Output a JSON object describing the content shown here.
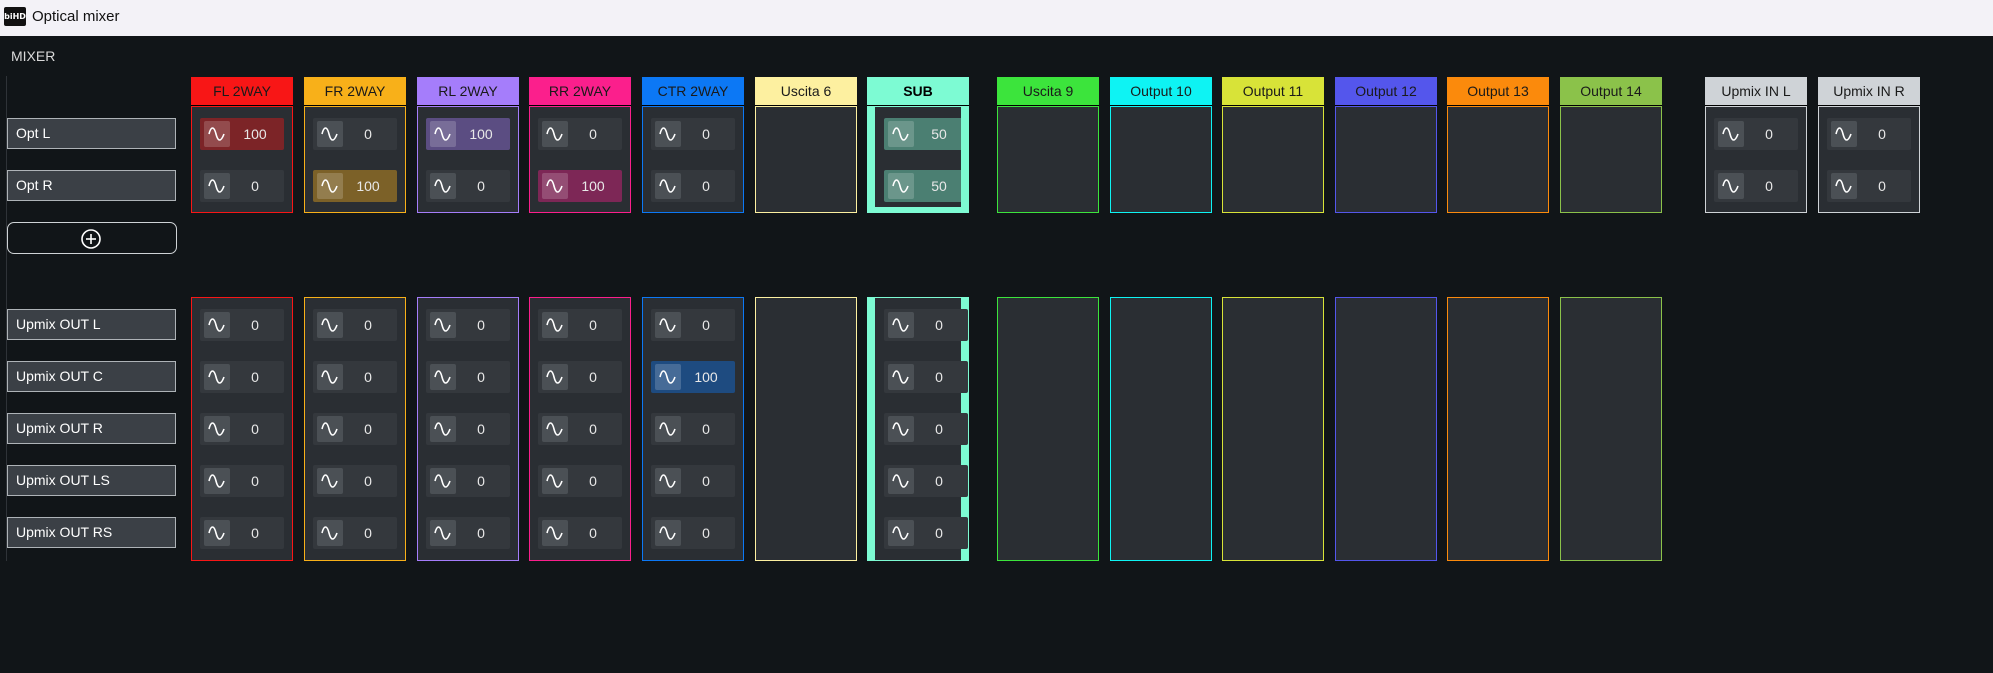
{
  "window": {
    "title": "Optical mixer",
    "logo_text": "biHD"
  },
  "section": {
    "label": "MIXER"
  },
  "rows_top": [
    "Opt L",
    "Opt R"
  ],
  "rows_bottom": [
    "Upmix OUT L",
    "Upmix OUT C",
    "Upmix OUT R",
    "Upmix OUT LS",
    "Upmix OUT RS"
  ],
  "columns": [
    {
      "label": "FL 2WAY",
      "color": "#f81616",
      "header_text": "#1a1a1a",
      "top": [
        {
          "v": "100",
          "hl": true
        },
        {
          "v": "0",
          "hl": false
        }
      ],
      "bottom": [
        "0",
        "0",
        "0",
        "0",
        "0"
      ],
      "bottom_hl": [
        false,
        false,
        false,
        false,
        false
      ]
    },
    {
      "label": "FR 2WAY",
      "color": "#f8b019",
      "header_text": "#1a1a1a",
      "top": [
        {
          "v": "0",
          "hl": false
        },
        {
          "v": "100",
          "hl": true
        }
      ],
      "bottom": [
        "0",
        "0",
        "0",
        "0",
        "0"
      ],
      "bottom_hl": [
        false,
        false,
        false,
        false,
        false
      ]
    },
    {
      "label": "RL 2WAY",
      "color": "#a57dfb",
      "header_text": "#1a1a1a",
      "top": [
        {
          "v": "100",
          "hl": true
        },
        {
          "v": "0",
          "hl": false
        }
      ],
      "bottom": [
        "0",
        "0",
        "0",
        "0",
        "0"
      ],
      "bottom_hl": [
        false,
        false,
        false,
        false,
        false
      ]
    },
    {
      "label": "RR 2WAY",
      "color": "#fb1f8c",
      "header_text": "#1a1a1a",
      "top": [
        {
          "v": "0",
          "hl": false
        },
        {
          "v": "100",
          "hl": true
        }
      ],
      "bottom": [
        "0",
        "0",
        "0",
        "0",
        "0"
      ],
      "bottom_hl": [
        false,
        false,
        false,
        false,
        false
      ]
    },
    {
      "label": "CTR 2WAY",
      "color": "#0c78f5",
      "header_text": "#1a1a1a",
      "top": [
        {
          "v": "0",
          "hl": false
        },
        {
          "v": "0",
          "hl": false
        }
      ],
      "bottom": [
        "0",
        "100",
        "0",
        "0",
        "0"
      ],
      "bottom_hl": [
        false,
        true,
        false,
        false,
        false
      ]
    },
    {
      "label": "Uscita 6",
      "color": "#fdf0a0",
      "header_text": "#1a1a1a",
      "top": [],
      "bottom": [],
      "bottom_hl": []
    },
    {
      "label": "SUB",
      "color": "#7dfbd3",
      "header_text": "#000000",
      "sub": true,
      "top": [
        {
          "v": "50",
          "hl": true
        },
        {
          "v": "50",
          "hl": true
        }
      ],
      "bottom": [
        "0",
        "0",
        "0",
        "0",
        "0"
      ],
      "bottom_hl": [
        false,
        false,
        false,
        false,
        false
      ]
    },
    {
      "label": "Uscita 9",
      "color": "#3ce43c",
      "header_text": "#1a1a1a",
      "top": [],
      "bottom": [],
      "bottom_hl": []
    },
    {
      "label": "Output 10",
      "color": "#0ef3f3",
      "header_text": "#1a1a1a",
      "top": [],
      "bottom": [],
      "bottom_hl": []
    },
    {
      "label": "Output 11",
      "color": "#d8e338",
      "header_text": "#1a1a1a",
      "top": [],
      "bottom": [],
      "bottom_hl": []
    },
    {
      "label": "Output 12",
      "color": "#5456ec",
      "header_text": "#1a1a1a",
      "top": [],
      "bottom": [],
      "bottom_hl": []
    },
    {
      "label": "Output 13",
      "color": "#fb8a0c",
      "header_text": "#1a1a1a",
      "top": [],
      "bottom": [],
      "bottom_hl": []
    },
    {
      "label": "Output 14",
      "color": "#8bc24a",
      "header_text": "#1a1a1a",
      "top": [],
      "bottom": [],
      "bottom_hl": []
    },
    {
      "label": "Upmix IN L",
      "color": "#cfd3d7",
      "header_text": "#1a1a1a",
      "top": [
        {
          "v": "0",
          "hl": false
        },
        {
          "v": "0",
          "hl": false
        }
      ],
      "bottom": null,
      "bottom_hl": []
    },
    {
      "label": "Upmix IN R",
      "color": "#cfd3d7",
      "header_text": "#1a1a1a",
      "top": [
        {
          "v": "0",
          "hl": false
        },
        {
          "v": "0",
          "hl": false
        }
      ],
      "bottom": null,
      "bottom_hl": []
    }
  ],
  "icons": {
    "waveform": "sine-wave-icon",
    "add": "plus-circle-icon"
  }
}
